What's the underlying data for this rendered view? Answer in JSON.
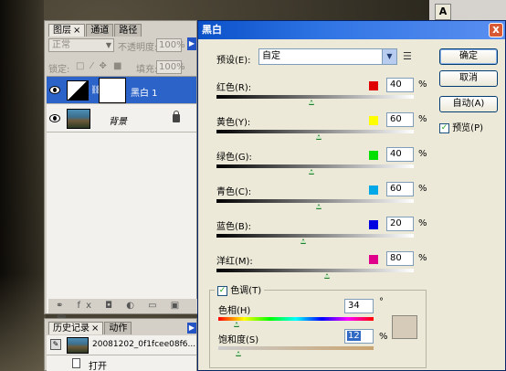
{
  "layers_panel": {
    "tabs": [
      "图层",
      "通道",
      "路径"
    ],
    "close_glyph": "×",
    "blend_mode": "正常",
    "opacity_label": "不透明度:",
    "opacity_value": "100%",
    "lock_label": "锁定:",
    "fill_label": "填充:",
    "fill_value": "100%",
    "layers": [
      {
        "name": "黑白 1",
        "selected": true,
        "type": "adjustment"
      },
      {
        "name": "背景",
        "selected": false,
        "type": "photo",
        "locked": true
      }
    ],
    "footer_icons": [
      "link-icon",
      "fx-icon",
      "mask-icon",
      "adjustment-icon",
      "group-icon",
      "new-layer-icon",
      "trash-icon"
    ]
  },
  "history_panel": {
    "tabs": [
      "历史记录",
      "动作"
    ],
    "close_glyph": "×",
    "snapshot_name": "20081202_0f1fcee08f6...",
    "steps": [
      "打开"
    ]
  },
  "toolbar_right": {
    "icon_glyph": "A",
    "icon_name": "text-tool-icon"
  },
  "dialog": {
    "title": "黑白",
    "close_glyph": "x",
    "preset_label": "预设(E):",
    "preset_value": "自定",
    "buttons": {
      "ok": "确定",
      "cancel": "取消",
      "auto": "自动(A)"
    },
    "preview_label": "预览(P)",
    "preview_checked": true,
    "sliders": [
      {
        "label": "红色(R):",
        "value": "40",
        "swatch": "#e00000",
        "pos": 0.48
      },
      {
        "label": "黄色(Y):",
        "value": "60",
        "swatch": "#ffff00",
        "pos": 0.52
      },
      {
        "label": "绿色(G):",
        "value": "40",
        "swatch": "#00e000",
        "pos": 0.48
      },
      {
        "label": "青色(C):",
        "value": "60",
        "swatch": "#00a8e8",
        "pos": 0.52
      },
      {
        "label": "蓝色(B):",
        "value": "20",
        "swatch": "#0000e0",
        "pos": 0.44
      },
      {
        "label": "洋红(M):",
        "value": "80",
        "swatch": "#e0008c",
        "pos": 0.56
      }
    ],
    "percent_sign": "%",
    "tint": {
      "label": "色调(T)",
      "checked": true,
      "hue_label": "色相(H)",
      "hue_value": "34",
      "degree_sign": "°",
      "saturation_label": "饱和度(S)",
      "saturation_value": "12",
      "swatch_color": "#d6cbb8"
    }
  }
}
